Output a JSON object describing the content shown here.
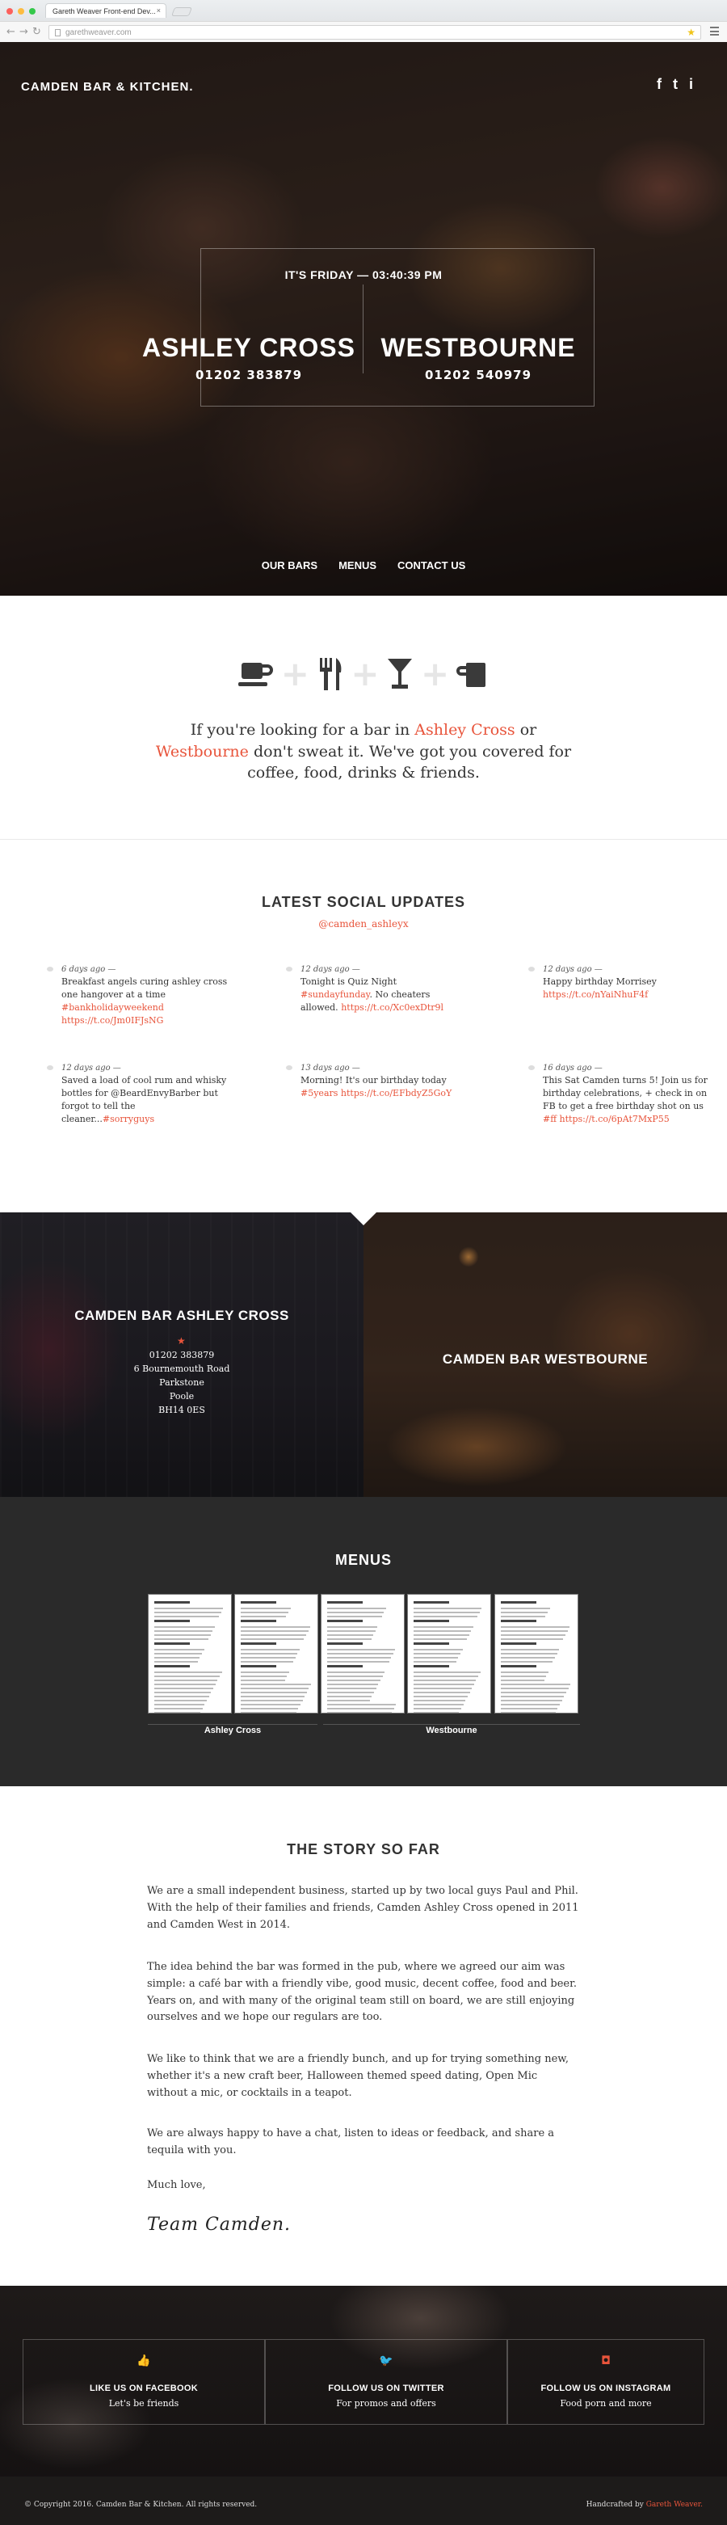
{
  "browser": {
    "tab_title": "Gareth Weaver Front-end Dev...",
    "tab_close": "×",
    "url": "garethweaver.com",
    "back_icon": "back-arrow",
    "forward_icon": "forward-arrow",
    "reload_icon": "reload",
    "bookmark_icon": "star"
  },
  "hero": {
    "brand": "CAMDEN BAR & KITCHEN.",
    "social": [
      "f",
      "t",
      "i"
    ],
    "day_line": "IT'S FRIDAY — 03:40:39 PM",
    "locations": [
      {
        "name": "ASHLEY CROSS",
        "phone": "01202 383879"
      },
      {
        "name": "WESTBOURNE",
        "phone": "01202 540979"
      }
    ],
    "nav": [
      "OUR BARS",
      "MENUS",
      "CONTACT US"
    ]
  },
  "intro": {
    "before": "If you're looking for a bar in ",
    "link1": "Ashley Cross",
    "middle": " or ",
    "link2": "Westbourne",
    "after": " don't sweat it. We've got you covered for coffee, food, drinks & friends."
  },
  "social_updates": {
    "title": "LATEST SOCIAL UPDATES",
    "handle": "@camden_ashleyx",
    "tweets": [
      {
        "time": "6 days ago —",
        "parts": [
          {
            "t": "Breakfast angels curing ashley cross one hangover at a time "
          },
          {
            "t": "#bankholidayweekend",
            "a": true
          },
          {
            "t": " "
          },
          {
            "t": "https://t.co/Jm0IFJsNG",
            "a": true
          }
        ]
      },
      {
        "time": "12 days ago —",
        "parts": [
          {
            "t": "Tonight is Quiz Night "
          },
          {
            "t": "#sundayfunday",
            "a": true
          },
          {
            "t": ". No cheaters allowed. "
          },
          {
            "t": "https://t.co/Xc0exDtr9l",
            "a": true
          }
        ]
      },
      {
        "time": "12 days ago —",
        "parts": [
          {
            "t": "Happy birthday Morrisey "
          },
          {
            "t": "https://t.co/nYaiNhuF4f",
            "a": true
          }
        ]
      },
      {
        "time": "12 days ago —",
        "parts": [
          {
            "t": "Saved a load of cool rum and whisky bottles for @BeardEnvyBarber but forgot to tell the cleaner..."
          },
          {
            "t": "#sorryguys",
            "a": true
          }
        ]
      },
      {
        "time": "13 days ago —",
        "parts": [
          {
            "t": "Morning! It's our birthday today "
          },
          {
            "t": "#5years",
            "a": true
          },
          {
            "t": " "
          },
          {
            "t": "https://t.co/EFbdyZ5GoY",
            "a": true
          }
        ]
      },
      {
        "time": "16 days ago —",
        "parts": [
          {
            "t": "This Sat Camden turns 5! Join us for birthday celebrations, + check in on FB to get a free birthday shot on us "
          },
          {
            "t": "#ff",
            "a": true
          },
          {
            "t": " "
          },
          {
            "t": "https://t.co/6pAt7MxP55",
            "a": true
          }
        ]
      }
    ]
  },
  "bars": {
    "ashley": {
      "title": "CAMDEN BAR ASHLEY CROSS",
      "address": [
        "01202 383879",
        "6 Bournemouth Road",
        "Parkstone",
        "Poole",
        "BH14 0ES"
      ]
    },
    "westbourne": {
      "title": "CAMDEN BAR WESTBOURNE"
    }
  },
  "menus": {
    "title": "MENUS",
    "groups": [
      "Ashley Cross",
      "Westbourne"
    ]
  },
  "story": {
    "title": "THE STORY SO FAR",
    "paragraphs": [
      "We are a small independent business, started up by two local guys Paul and Phil. With the help of their families and friends, Camden Ashley Cross opened in 2011 and Camden West in 2014.",
      "The idea behind the bar was formed in the pub, where we agreed our aim was simple: a café bar with a friendly vibe, good music, decent coffee, food and beer. Years on, and with many of the original team still on board, we are still enjoying ourselves and we hope our regulars are too.",
      "We like to think that we are a friendly bunch, and up for trying something new, whether it's a new craft beer, Halloween themed speed dating, Open Mic without a mic, or cocktails in a teapot.",
      "We are always happy to have a chat, listen to ideas or feedback, and share a tequila with you.",
      "Much love,"
    ],
    "signature": "Team Camden."
  },
  "follow": [
    {
      "icon": "thumbs-up",
      "glyph": "👍",
      "head": "LIKE US ON FACEBOOK",
      "sub": "Let's be friends"
    },
    {
      "icon": "twitter",
      "glyph": "🐦",
      "head": "FOLLOW US ON TWITTER",
      "sub": "For promos and offers"
    },
    {
      "icon": "instagram",
      "glyph": "◘",
      "head": "FOLLOW US ON INSTAGRAM",
      "sub": "Food porn and more"
    }
  ],
  "footer": {
    "copyright": "© Copyright 2016. Camden Bar & Kitchen. All rights reserved.",
    "credit_prefix": "Handcrafted by ",
    "credit_name": "Gareth Weaver."
  },
  "colors": {
    "accent": "#e8543b",
    "dark": "#2a2a2a"
  }
}
